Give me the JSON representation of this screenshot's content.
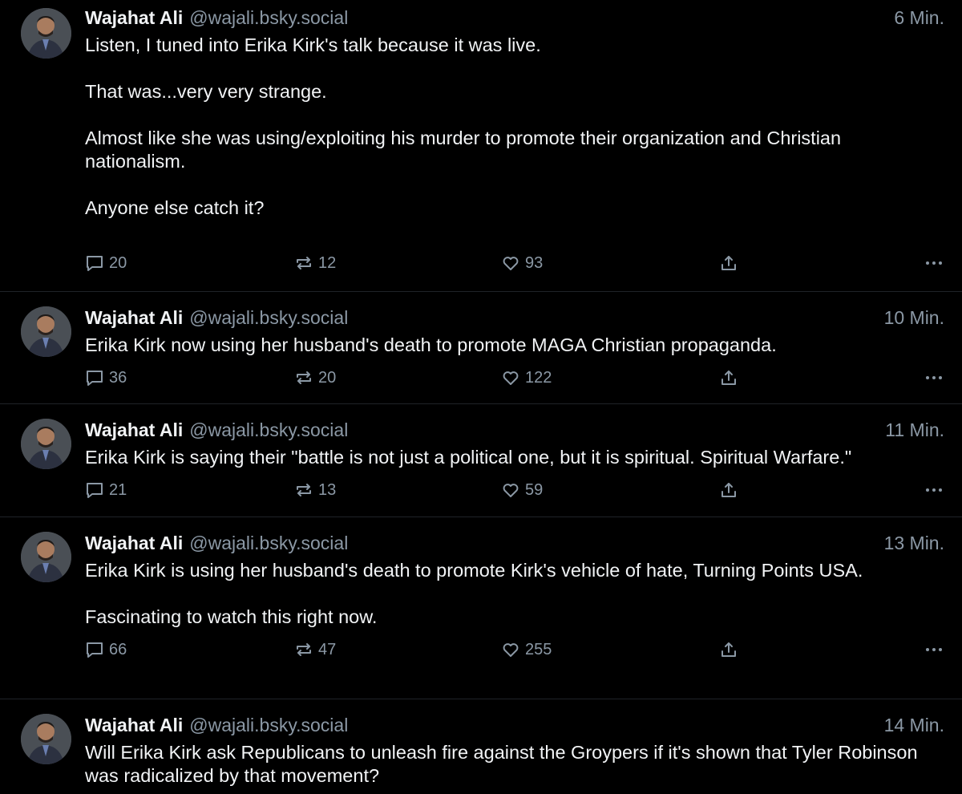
{
  "posts": [
    {
      "author": "Wajahat Ali",
      "handle": "@wajali.bsky.social",
      "time": "6 Min.",
      "paragraphs": [
        "Listen, I tuned into Erika Kirk's talk because it was live.",
        "That was...very very strange.",
        "Almost like she was using/exploiting his murder to promote their organization and Christian nationalism.",
        "Anyone else catch it?"
      ],
      "replies": "20",
      "reposts": "12",
      "likes": "93"
    },
    {
      "author": "Wajahat Ali",
      "handle": "@wajali.bsky.social",
      "time": "10 Min.",
      "paragraphs": [
        "Erika Kirk now using her husband's death to promote MAGA Christian propaganda."
      ],
      "replies": "36",
      "reposts": "20",
      "likes": "122"
    },
    {
      "author": "Wajahat Ali",
      "handle": "@wajali.bsky.social",
      "time": "11 Min.",
      "paragraphs": [
        "Erika Kirk is saying their \"battle is not just a political one, but it is spiritual. Spiritual Warfare.\""
      ],
      "replies": "21",
      "reposts": "13",
      "likes": "59"
    },
    {
      "author": "Wajahat Ali",
      "handle": "@wajali.bsky.social",
      "time": "13 Min.",
      "paragraphs": [
        "Erika Kirk is using her husband's death to promote Kirk's vehicle of hate, Turning Points USA.",
        "Fascinating to watch this right now."
      ],
      "replies": "66",
      "reposts": "47",
      "likes": "255"
    },
    {
      "author": "Wajahat Ali",
      "handle": "@wajali.bsky.social",
      "time": "14 Min.",
      "paragraphs": [
        "Will Erika Kirk ask Republicans to unleash fire against the Groypers if it's shown that Tyler Robinson was radicalized by that movement?"
      ],
      "replies": "",
      "reposts": "",
      "likes": ""
    }
  ],
  "icons": {
    "reply": "reply-icon",
    "repost": "repost-icon",
    "like": "heart-icon",
    "share": "share-icon",
    "more": "more-icon"
  },
  "colors": {
    "background": "#000000",
    "text": "#f1f3f5",
    "muted": "#8b98a5",
    "divider": "#1f2328"
  }
}
